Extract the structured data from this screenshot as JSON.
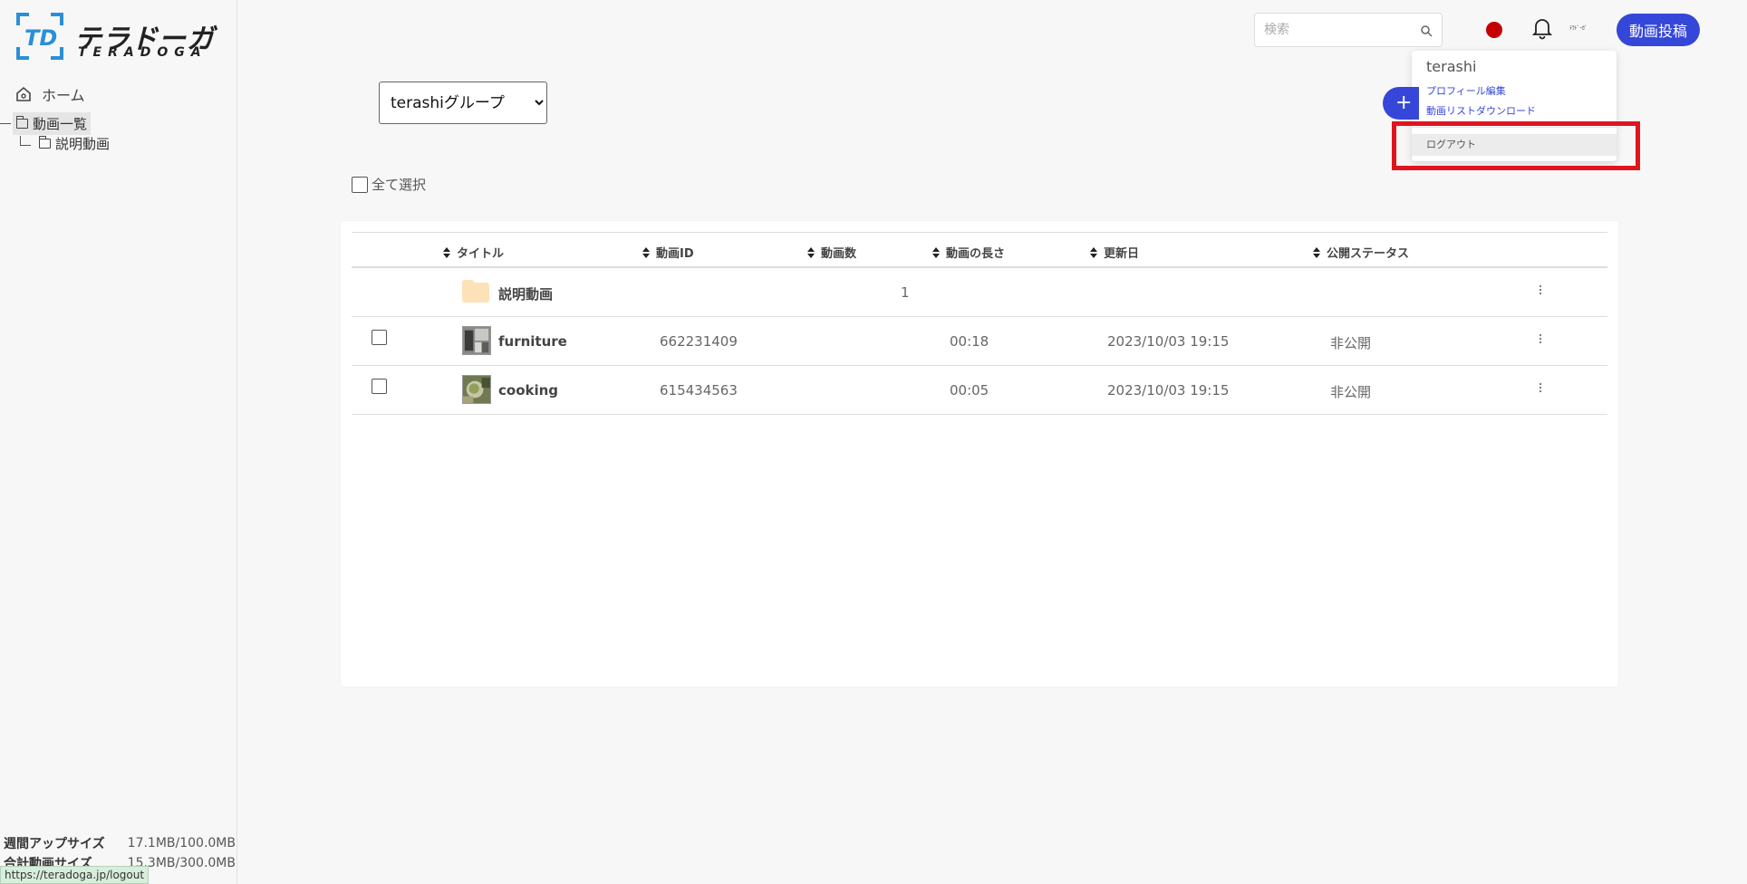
{
  "brand": {
    "name_jp": "テラドーガ",
    "name_en": "TERADOGA"
  },
  "sidebar": {
    "home_label": "ホーム",
    "tree_root_label": "動画一覧",
    "tree_child_label": "説明動画",
    "usage": [
      {
        "label": "週間アップサイズ",
        "value": "17.1MB/100.0MB"
      },
      {
        "label": "合計動画サイズ",
        "value": "15.3MB/300.0MB"
      }
    ]
  },
  "status_bar": {
    "url": "https://teradoga.jp/logout"
  },
  "header": {
    "search_placeholder": "検索",
    "upload_label": "動画投稿",
    "avatar_text": "ﾃﾗﾄﾞｰｶﾞ"
  },
  "user_menu": {
    "username": "terashi",
    "items": [
      "プロフィール編集",
      "動画リストダウンロード"
    ],
    "logout_label": "ログアウト"
  },
  "main": {
    "group_options": [
      "terashiグループ"
    ],
    "select_all_label": "全て選択",
    "add_label": "+",
    "columns": [
      "タイトル",
      "動画ID",
      "動画数",
      "動画の長さ",
      "更新日",
      "公開ステータス"
    ],
    "rows": [
      {
        "type": "folder",
        "title": "説明動画",
        "video_id": "",
        "count": "1",
        "duration": "",
        "updated": "",
        "status": ""
      },
      {
        "type": "video",
        "title": "furniture",
        "video_id": "662231409",
        "count": "",
        "duration": "00:18",
        "updated": "2023/10/03 19:15",
        "status": "非公開"
      },
      {
        "type": "video",
        "title": "cooking",
        "video_id": "615434563",
        "count": "",
        "duration": "00:05",
        "updated": "2023/10/03 19:15",
        "status": "非公開"
      }
    ]
  },
  "colors": {
    "accent": "#3547d8",
    "highlight": "#e0141f",
    "folder": "#fde2b8",
    "flag": "#c40000"
  }
}
